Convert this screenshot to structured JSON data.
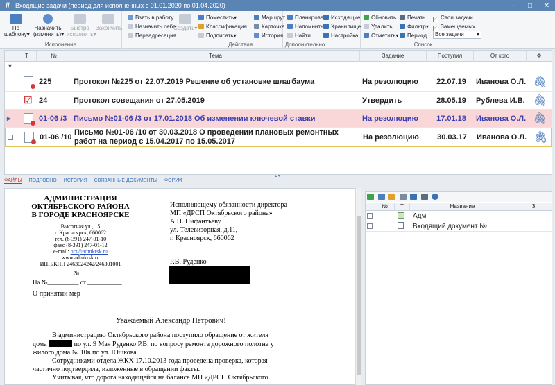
{
  "window": {
    "title": "Входящие задачи (период для исполненных с 01.01.2020 по 01.04.2020)",
    "min": "–",
    "max": "□",
    "close": "✕"
  },
  "ribbon": {
    "template": {
      "label1": "По",
      "label2": "шаблону"
    },
    "assign": {
      "label1": "Назначить",
      "label2": "(изменить)"
    },
    "fast": {
      "label1": "Быстро",
      "label2": "исполнить"
    },
    "complete": "Закончить",
    "take": "Взять в работу",
    "assign_self": "Назначить себе",
    "redirect": "Переадресация",
    "create": "Создать",
    "place": "Поместить",
    "classify": "Классификация",
    "sign": "Подписать",
    "route": "Маршрут",
    "card": "Карточка",
    "history": "История",
    "plan": "Планировать",
    "remind": "Напомнить",
    "find": "Найти",
    "outgoing": "Исходящие",
    "storage": "Хранилище",
    "settings": "Настройка",
    "refresh": "Обновить",
    "delete": "Удалить",
    "mark": "Отметить",
    "print": "Печать",
    "filter": "Фильтр",
    "period": "Период",
    "own": "Свои задачи",
    "substitute": "Замещаемых",
    "selector": "Все задачи",
    "groups": {
      "execution": "Исполнение",
      "actions": "Действия",
      "extra": "Дополнительно",
      "list": "Список"
    }
  },
  "grid": {
    "headers": {
      "t": "Т",
      "num": "№",
      "topic": "Тема",
      "task": "Задание",
      "received": "Поступил",
      "from": "От кого",
      "attach": "Ф"
    },
    "rows": [
      {
        "num": "225",
        "topic": "Протокол №225 от 22.07.2019 Решение об установке шлагбаума",
        "task": "На резолюцию",
        "date": "22.07.19",
        "from": "Иванова О.Л."
      },
      {
        "num": "24",
        "topic": "Протокол совещания от 27.05.2019",
        "task": "Утвердить",
        "date": "28.05.19",
        "from": "Рублева И.В."
      },
      {
        "num": "01-06 /3",
        "topic": "Письмо №01-06 /3 от 17.01.2018 Об изменении ключевой ставки",
        "task": "На резолюцию",
        "date": "17.01.18",
        "from": "Иванова О.Л."
      },
      {
        "num": "01-06 /10",
        "topic": "Письмо №01-06 /10 от 30.03.2018 О проведении плановых ремонтных работ на период с 15.04.2017 по 15.05.2017",
        "task": "На резолюцию",
        "date": "30.03.17",
        "from": "Иванова О.Л."
      }
    ]
  },
  "tabs": {
    "files": "ФАЙЛЫ",
    "details": "ПОДРОБНО",
    "history": "ИСТОРИЯ",
    "linked": "СВЯЗАННЫЕ ДОКУМЕНТЫ",
    "forum": "ФОРУМ"
  },
  "letter": {
    "org1": "АДМИНИСТРАЦИЯ",
    "org2": "ОКТЯБРЬСКОГО РАЙОНА",
    "org3": "В ГОРОДЕ КРАСНОЯРСКЕ",
    "addr1": "Высотная ул., 15",
    "addr2": "г. Красноярск, 660062",
    "tel": "тел. (8-391) 247-01-10",
    "fax": "факс (8-391) 247-01-12",
    "email_label": "e-mail:",
    "email": "oct@admkrsk.ru",
    "web": "www.admkrsk.ru",
    "inn": "ИНН/КПП 2463024242/246301001",
    "no_line": "№",
    "on_line1": "На",
    "on_line2": "№",
    "on_line3": "от",
    "subject": "О принятии мер",
    "to1": "Исполняющему обязанности  директора",
    "to2": "МП «ДРСП Октябрьского района»",
    "to3": "А.П. Нифантьеву",
    "to4": "ул. Телевизорная, д.11,",
    "to5": "г. Красноярск, 660062",
    "cc": "Р.В. Руденко",
    "greeting": "Уважаемый Александр Петрович!",
    "p1a": "В администрацию Октябрьского района поступило обращение  от жителя",
    "p1b_pre": "дома",
    "p1b_post": "по ул. 9 Мая Руденко Р.В. по вопросу ремонта дорожного полотна  у",
    "p1c": "жилого дома № 10в по ул. Юшкова.",
    "p2a": "Сотрудниками отдела ЖКХ 17.10.2013 года проведена проверка, которая",
    "p2b": "частично подтвердила, изложенные в обращении факты.",
    "p3a": "Учитывая, что дорога находящейся на балансе МП «ДРСП Октябрьского"
  },
  "files": {
    "headers": {
      "num": "№",
      "t": "Т",
      "name": "Название",
      "z": "З"
    },
    "rows": [
      {
        "name": "Адм"
      },
      {
        "name": "Входящий документ №"
      }
    ]
  }
}
